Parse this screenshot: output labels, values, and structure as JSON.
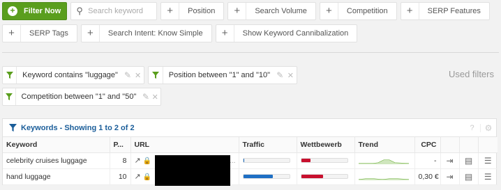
{
  "toolbar": {
    "filter_now_label": "Filter Now",
    "search_placeholder": "Search keyword",
    "filters": [
      "Position",
      "Search Volume",
      "Competition",
      "SERP Features",
      "SERP Tags",
      "Search Intent: Know Simple",
      "Show Keyword Cannibalization"
    ]
  },
  "used_filters_label": "Used filters",
  "active_filters": [
    "Keyword contains \"luggage\"",
    "Position between \"1\" and \"10\"",
    "Competition between \"1\" and \"50\""
  ],
  "panel": {
    "title": "Keywords - Showing 1 to 2 of 2",
    "help": "?",
    "columns": [
      "Keyword",
      "P...",
      "URL",
      "Traffic",
      "Wettbewerb",
      "Trend",
      "CPC"
    ],
    "rows": [
      {
        "keyword": "celebrity cruises luggage",
        "position": "8",
        "traffic": 0.03,
        "competition": 0.2,
        "cpc": "-"
      },
      {
        "keyword": "hand luggage",
        "position": "10",
        "traffic": 0.65,
        "competition": 0.48,
        "cpc": "0,30 €"
      }
    ]
  },
  "colors": {
    "primary_green": "#5a9e1d",
    "title_blue": "#1a5d99",
    "traffic_blue": "#1e6fc4",
    "competition_red": "#c8102e",
    "trend_green": "#5fa82a"
  },
  "icons": {
    "filter": "funnel-icon",
    "search": "search-icon",
    "edit": "pencil-icon",
    "remove": "close-icon",
    "settings": "gear-icon",
    "external": "external-link-icon",
    "secure": "lock-icon"
  }
}
